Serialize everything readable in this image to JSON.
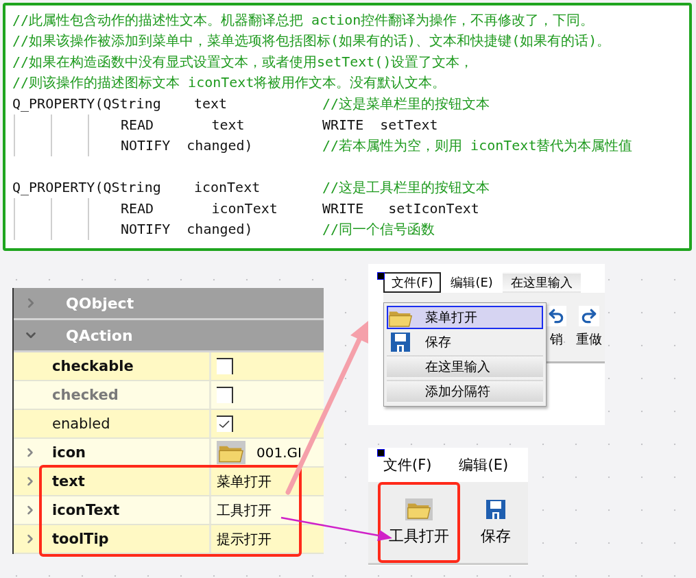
{
  "code_block": {
    "lines": [
      {
        "kind": "comment",
        "comment": "//此属性包含动作的描述性文本。机器翻译总把 action控件翻译为操作，不再修改了，下同。"
      },
      {
        "kind": "comment",
        "comment": "//如果该操作被添加到菜单中，菜单选项将包括图标(如果有的话)、文本和快捷键(如果有的话)。"
      },
      {
        "kind": "comment",
        "comment": "//如果在构造函数中没有显式设置文本，或者使用setText()设置了文本，"
      },
      {
        "kind": "comment",
        "comment": "//则该操作的描述图标文本 iconText将被用作文本。没有默认文本。"
      },
      {
        "kind": "declaration",
        "code": "Q_PROPERTY(QString    text",
        "tail": {
          "kind": "comment",
          "text": "//这是菜单栏里的按钮文本"
        }
      },
      {
        "kind": "continuation",
        "code": "READ       text",
        "tail": {
          "kind": "code",
          "text": "WRITE  setText"
        }
      },
      {
        "kind": "continuation",
        "code": "NOTIFY  changed)",
        "tail": {
          "kind": "comment",
          "text": "//若本属性为空，则用 iconText替代为本属性值"
        }
      },
      {
        "kind": "blank"
      },
      {
        "kind": "declaration",
        "code": "Q_PROPERTY(QString    iconText",
        "tail": {
          "kind": "comment",
          "text": "//这是工具栏里的按钮文本"
        }
      },
      {
        "kind": "continuation",
        "code": "READ       iconText",
        "tail": {
          "kind": "code",
          "text": "WRITE   setIconText"
        }
      },
      {
        "kind": "continuation",
        "code": "NOTIFY  changed)",
        "tail": {
          "kind": "comment",
          "text": "//同一个信号函数"
        }
      }
    ]
  },
  "property_editor": {
    "groups": [
      {
        "label": "QObject",
        "expanded": false
      },
      {
        "label": "QAction",
        "expanded": true
      }
    ],
    "properties": [
      {
        "name": "checkable",
        "modified": true,
        "disabled": false,
        "expandable": false,
        "highlighted": false,
        "kind": "checkbox",
        "checked": false
      },
      {
        "name": "checked",
        "modified": true,
        "disabled": true,
        "expandable": false,
        "highlighted": false,
        "kind": "checkbox",
        "checked": false
      },
      {
        "name": "enabled",
        "modified": false,
        "disabled": false,
        "expandable": false,
        "highlighted": false,
        "kind": "checkbox",
        "checked": true
      },
      {
        "name": "icon",
        "modified": true,
        "disabled": false,
        "expandable": true,
        "highlighted": false,
        "kind": "image",
        "value": "001.GI"
      },
      {
        "name": "text",
        "modified": true,
        "disabled": false,
        "expandable": true,
        "highlighted": true,
        "kind": "text",
        "value": "菜单打开"
      },
      {
        "name": "iconText",
        "modified": true,
        "disabled": false,
        "expandable": true,
        "highlighted": true,
        "kind": "text",
        "value": "工具打开"
      },
      {
        "name": "toolTip",
        "modified": true,
        "disabled": false,
        "expandable": true,
        "highlighted": true,
        "kind": "text",
        "value": "提示打开"
      }
    ]
  },
  "menu_designer": {
    "menubar": [
      {
        "label": "文件(F)",
        "kind": "menu",
        "selected": true
      },
      {
        "label": "编辑(E)",
        "kind": "menu",
        "selected": false
      },
      {
        "label": "在这里输入",
        "kind": "placeholder",
        "selected": false
      }
    ],
    "toolbar": [
      {
        "label": "销",
        "kind": "undo"
      },
      {
        "label": "重做",
        "kind": "redo"
      }
    ],
    "menu": [
      {
        "label": "菜单打开",
        "kind": "open",
        "selected": true
      },
      {
        "label": "保存",
        "kind": "save",
        "selected": false
      },
      {
        "label": "在这里输入",
        "kind": "placeholder",
        "selected": false
      },
      {
        "label": "添加分隔符",
        "kind": "placeholder",
        "selected": false
      }
    ]
  },
  "toolbar_preview": {
    "menubar": [
      {
        "label": "文件(F)"
      },
      {
        "label": "编辑(E)"
      }
    ],
    "toolbar": [
      {
        "label": "工具打开",
        "kind": "open",
        "highlighted": true
      },
      {
        "label": "保存",
        "kind": "save",
        "highlighted": false
      }
    ]
  }
}
